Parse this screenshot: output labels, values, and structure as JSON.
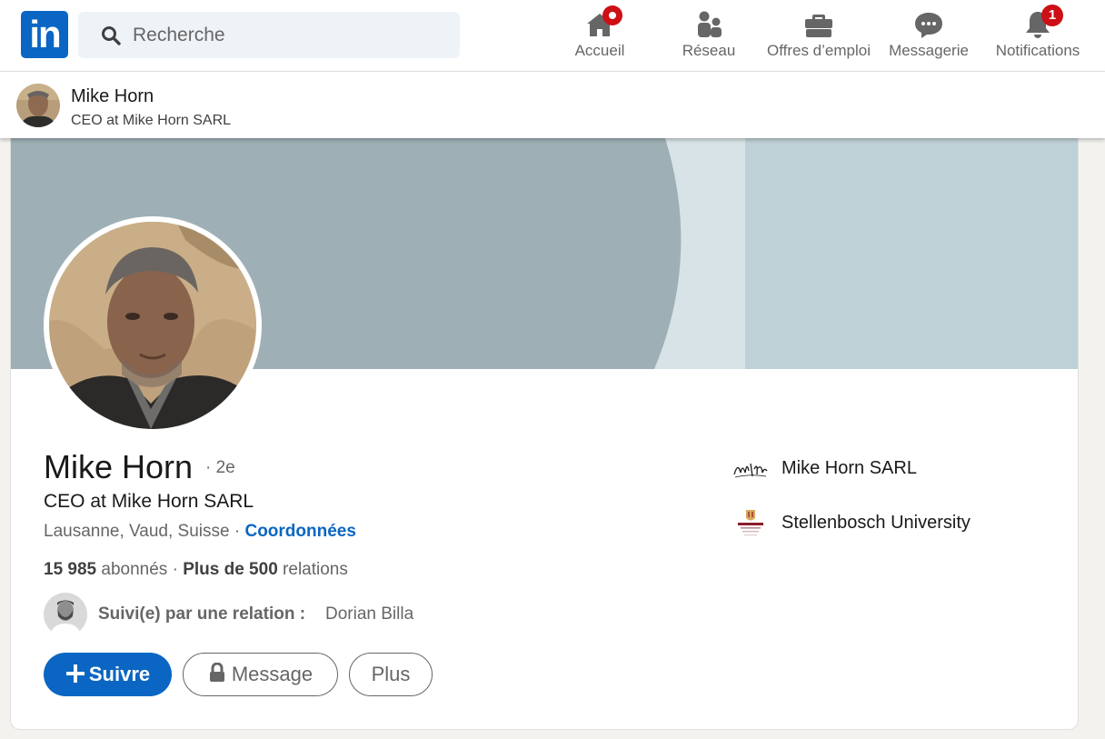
{
  "nav": {
    "logo_text": "in",
    "search_placeholder": "Recherche",
    "items": [
      {
        "label": "Accueil",
        "icon": "home-icon"
      },
      {
        "label": "Réseau",
        "icon": "network-icon"
      },
      {
        "label": "Offres d’emploi",
        "icon": "briefcase-icon"
      },
      {
        "label": "Messagerie",
        "icon": "messaging-icon"
      },
      {
        "label": "Notifications",
        "icon": "bell-icon",
        "badge": "1"
      }
    ]
  },
  "sticky": {
    "name": "Mike Horn",
    "headline": "CEO at Mike Horn SARL"
  },
  "profile": {
    "name": "Mike Horn",
    "degree": "· 2e",
    "headline": "CEO at Mike Horn SARL",
    "location": "Lausanne, Vaud, Suisse",
    "separator": " · ",
    "contact_link": "Coordonnées",
    "followers_count": "15 985",
    "followers_label": " abonnés ",
    "connections_prefix": " · ",
    "connections_count": "Plus de 500",
    "connections_label": " relations",
    "followed_by_label": "Suivi(e) par une relation :",
    "followed_by_name": "Dorian Billa",
    "experience": [
      {
        "name": "Mike Horn SARL",
        "logo_text": "Mike Horn"
      },
      {
        "name": "Stellenbosch University",
        "logo_text": "Stellenbosch"
      }
    ]
  },
  "actions": {
    "follow": "Suivre",
    "message": "Message",
    "more": "Plus"
  },
  "colors": {
    "brand": "#0a66c2",
    "badge": "#cc1016",
    "cover_dark": "#9eb0b5",
    "cover_light": "#bed1d6"
  }
}
